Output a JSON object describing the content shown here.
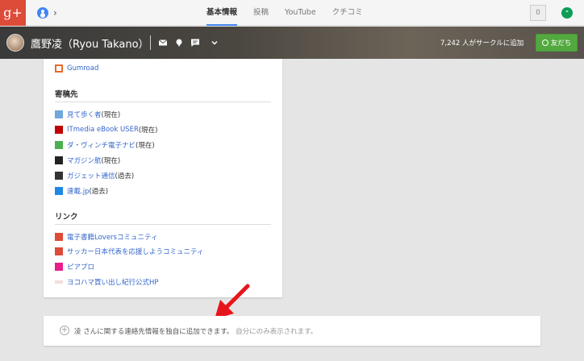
{
  "app": {
    "logo_text": "g+"
  },
  "tabs": [
    {
      "label": "基本情報",
      "active": true
    },
    {
      "label": "投稿",
      "active": false
    },
    {
      "label": "YouTube",
      "active": false
    },
    {
      "label": "クチコミ",
      "active": false
    }
  ],
  "notifications": {
    "count": "0"
  },
  "profile": {
    "name": "鷹野凌（Ryou Takano）",
    "circle_count": "7,242 人がサークルに追加",
    "friends_button": "友だち"
  },
  "icons": [
    "gplus-logo",
    "profile-icon",
    "chevron-right-icon",
    "notification-icon",
    "hangouts-icon",
    "mail-icon",
    "location-icon",
    "comment-icon",
    "chevron-down-icon"
  ],
  "card": {
    "top_link": {
      "label": "Gumroad",
      "favicon_color": "#e86a2b"
    },
    "contributor": {
      "heading": "寄稿先",
      "items": [
        {
          "label": "見て歩く者",
          "note": "(現在)",
          "favicon_color": "#6fa8dc"
        },
        {
          "label": "ITmedia eBook USER",
          "note": "(現在)",
          "favicon_color": "#c00000"
        },
        {
          "label": "ダ・ヴィンチ電子ナビ",
          "note": "(現在)",
          "favicon_color": "#4caf50"
        },
        {
          "label": "マガジン航",
          "note": "(現在)",
          "favicon_color": "#222222"
        },
        {
          "label": "ガジェット通信",
          "note": "(過去)",
          "favicon_color": "#333333"
        },
        {
          "label": "連載.jp",
          "note": "(過去)",
          "favicon_color": "#1e88e5"
        }
      ]
    },
    "links": {
      "heading": "リンク",
      "items": [
        {
          "label": "電子書籍Loversコミュニティ",
          "favicon_color": "#dd4b39"
        },
        {
          "label": "サッカー日本代表を応援しようコミュニティ",
          "favicon_color": "#dd4b39"
        },
        {
          "label": "ピアプロ",
          "favicon_color": "#e91e8c"
        },
        {
          "label": "ヨコハマ買い出し紀行公式HP",
          "favicon_color": "#b07070"
        }
      ]
    }
  },
  "contact_prompt": {
    "text": "凌 さんに関する連絡先情報を独自に追加できます。",
    "subtext": "自分にのみ表示されます。"
  },
  "colors": {
    "accent": "#4285f4",
    "brand": "#dd4b39",
    "friends": "#53a93f",
    "link": "#3366cc",
    "arrow": "#e8141c"
  }
}
